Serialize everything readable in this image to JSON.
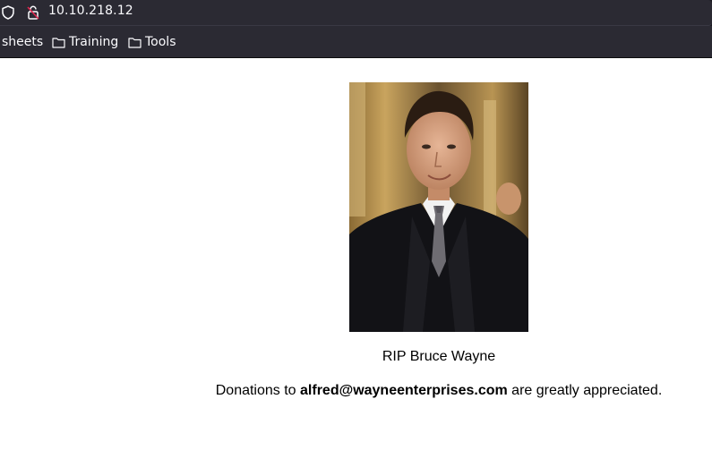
{
  "browser": {
    "url": "10.10.218.12",
    "bookmarks": [
      {
        "label": "sheets",
        "icon": "none"
      },
      {
        "label": "Training",
        "icon": "folder-icon"
      },
      {
        "label": "Tools",
        "icon": "folder-icon"
      }
    ]
  },
  "page": {
    "caption": "RIP Bruce Wayne",
    "donation_prefix": "Donations to ",
    "donation_email": "alfred@wayneenterprises.com",
    "donation_suffix": " are greatly appreciated."
  },
  "colors": {
    "toolbar_bg": "#2b2a33",
    "toolbar_text": "#fbfbfe",
    "page_bg": "#ffffff"
  }
}
